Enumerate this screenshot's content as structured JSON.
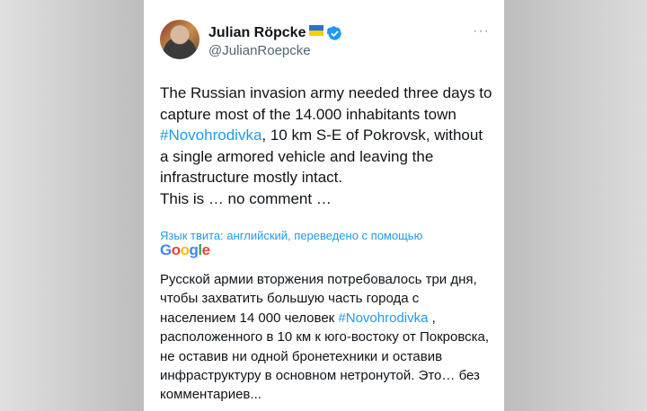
{
  "author": {
    "display_name": "Julian Röpcke",
    "handle": "@JulianRoepcke"
  },
  "icons": {
    "flag": "ukraine-flag-icon",
    "verified": "verified-badge-icon",
    "more": "more-options-icon"
  },
  "colors": {
    "link": "#1d9bf0",
    "text": "#0f1419",
    "secondary": "#536471"
  },
  "tweet": {
    "part1": "The Russian invasion army needed three days to capture most of the 14.000 inhabitants town ",
    "hashtag": "#Novohrodivka",
    "part2": ", 10 km S-E of Pokrovsk, without a single armored vehicle and leaving the infrastructure mostly intact.",
    "part3": "This is … no comment …"
  },
  "translation": {
    "label": "Язык твита: английский, переведено с помощью",
    "provider": "Google",
    "part1": "Русской армии вторжения потребовалось три дня, чтобы захватить большую часть города с населением 14 000 человек ",
    "hashtag": "#Novohrodivka",
    "part2": " , расположенного в 10 км к юго-востоку от Покровска, не оставив ни одной бронетехники и оставив инфраструктуру в основном нетронутой. Это… без комментариев..."
  }
}
